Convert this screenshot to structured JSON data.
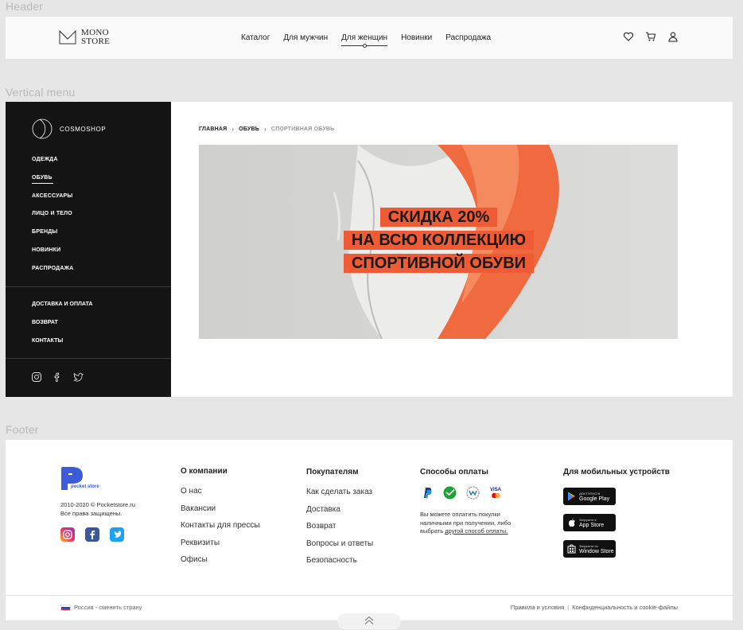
{
  "sections": {
    "header": "Header",
    "vertical_menu": "Vertical menu",
    "footer": "Footer"
  },
  "header": {
    "logo_line1": "MONO",
    "logo_line2": "STORE",
    "nav": [
      "Каталог",
      "Для мужчин",
      "Для женщин",
      "Новинки",
      "Распродажа"
    ],
    "active_nav": "Для женщин",
    "icons": [
      "heart-icon",
      "cart-icon",
      "user-icon"
    ]
  },
  "sidebar": {
    "logo": "COSMOSHOP",
    "menu": [
      "ОДЕЖДА",
      "ОБУВЬ",
      "АКСЕССУАРЫ",
      "ЛИЦО И ТЕЛО",
      "БРЕНДЫ",
      "НОВИНКИ",
      "РАСПРОДАЖА"
    ],
    "active": "ОБУВЬ",
    "menu2": [
      "ДОСТАВКА И ОПЛАТА",
      "ВОЗВРАТ",
      "КОНТАКТЫ"
    ],
    "social": [
      "instagram-icon",
      "facebook-icon",
      "twitter-icon"
    ]
  },
  "breadcrumb": [
    "ГЛАВНАЯ",
    "ОБУВЬ",
    "СПОРТИВНАЯ ОБУВЬ"
  ],
  "banner": {
    "lines": [
      "СКИДКА 20%",
      "НА ВСЮ КОЛЛЕКЦИЮ",
      "СПОРТИВНОЙ ОБУВИ"
    ],
    "accent": "#ef5b35"
  },
  "footer": {
    "logo": "pocket store",
    "copyright": "2010-2020 © Pocketstore.ru",
    "rights": "Все права защищены.",
    "social": [
      "instagram-icon",
      "facebook-icon",
      "twitter-icon"
    ],
    "about": {
      "title": "О компании",
      "links": [
        "О нас",
        "Вакансии",
        "Контакты для прессы",
        "Реквизиты",
        "Офисы"
      ]
    },
    "buyers": {
      "title": "Покупателям",
      "links": [
        "Как сделать заказ",
        "Доставка",
        "Возврат",
        "Вопросы и ответы",
        "Безопасность"
      ]
    },
    "payment": {
      "title": "Способы оплаты",
      "icons": [
        "paypal-icon",
        "sberbank-icon",
        "webmoney-icon",
        "visa-mastercard-icon"
      ],
      "text": "Вы можете оплатить покупки наличными при получении, либо выбрать",
      "link": "другой способ оплаты."
    },
    "mobile": {
      "title": "Для мобильных устройств",
      "stores": [
        {
          "small": "ДОСТУПНО В",
          "name": "Google Play"
        },
        {
          "small": "Загрузите в",
          "name": "App Store"
        },
        {
          "small": "Загрузите из",
          "name": "Window Store"
        }
      ]
    },
    "country": "Россия - сменить страну",
    "terms": "Правила и условия",
    "privacy": "Конфиденциальность и cookie-файлы"
  }
}
